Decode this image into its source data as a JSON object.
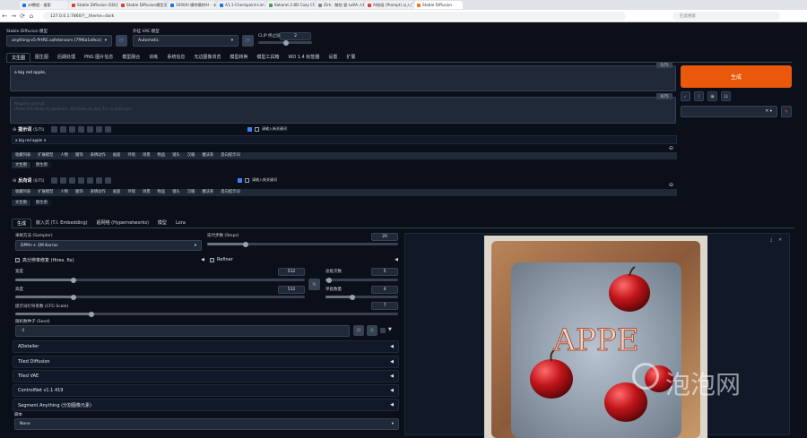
{
  "browser": {
    "tabs": [
      {
        "label": "sd教程 - 搜索",
        "color": "#1a73e8"
      },
      {
        "label": "Stable Diffusion (SD)是新",
        "color": "#e53935"
      },
      {
        "label": "Stable Diffusion模型怎么下载",
        "color": "#e53935"
      },
      {
        "label": "1000AI 模特模特AI - 卡哇伊风格",
        "color": "#1a73e8"
      },
      {
        "label": "A1.1-Checkpoint-Lim Lora - Lib",
        "color": "#1a73e8"
      },
      {
        "label": "Kakarot 2.8D Cozy Checkpoint",
        "color": "#43a047"
      },
      {
        "label": "Zirk：触觉·爱·LoRA·人物艺术",
        "color": "#888"
      },
      {
        "label": "AI绘画 (Prompt) 从入门",
        "color": "#e53935"
      },
      {
        "label": "Stable Diffusion",
        "color": "#f57c00"
      }
    ],
    "url": "127.0.0.1:7860/?__theme=dark",
    "search_placeholder": "在此搜索"
  },
  "header": {
    "model_label": "Stable Diffusion 模型",
    "model_value": "anything-v5-PrtRE.safetensors [7f96a1a9ca]",
    "vae_label": "外挂 VAE 模型",
    "vae_value": "Automatic",
    "clip_label": "CLIP 终止层数",
    "clip_value": "2"
  },
  "main_tabs": [
    "文生图",
    "图生图",
    "后期处理",
    "PNG 图片信息",
    "模型融合",
    "训练",
    "系统信息",
    "无边图像浏览",
    "模型转换",
    "模型工具箱",
    "WD 1.4 标签器",
    "设置",
    "扩展"
  ],
  "prompt": {
    "text": "a big red apple,",
    "counter": "5/75"
  },
  "negative": {
    "placeholder": "Negative prompt\n(Press Ctrl+Enter to generate, Alt+Enter to skip, Esc to interrupt)",
    "counter": "0/75"
  },
  "generate_label": "生成",
  "helper": {
    "pos_title": "提示词",
    "pos_count": "(5/75)",
    "pos_check": "请输入新关键词",
    "pos_tag": "a big red apple",
    "neg_title": "反向词",
    "neg_count": "(0/75)",
    "neg_check": "请输入新关键词",
    "cats": [
      "收藏列表",
      "扩展模型",
      "人物",
      "服饰",
      "表情动作",
      "画面",
      "环境",
      "场景",
      "物品",
      "镜头",
      "汉服",
      "魔法系",
      "反向提示词"
    ],
    "sub": [
      "文生图",
      "图生图"
    ]
  },
  "gen_tabs": [
    "生成",
    "嵌入式 (T.I. Embedding)",
    "超网络 (Hypernetworks)",
    "模型",
    "Lora"
  ],
  "params": {
    "sampler_label": "采样方法 (Sampler)",
    "sampler_value": "DPM++ 2M Karras",
    "steps_label": "迭代步数 (Steps)",
    "steps_value": "20",
    "steps_frac": 0.2,
    "hires_label": "高分辨率修复 (Hires. fix)",
    "refiner_label": "Refiner",
    "width_label": "宽度",
    "width_value": "512",
    "width_frac": 0.2,
    "height_label": "高度",
    "height_value": "512",
    "height_frac": 0.2,
    "batch_count_label": "总批次数",
    "batch_count_value": "5",
    "batch_count_frac": 0.05,
    "batch_size_label": "单批数量",
    "batch_size_value": "4",
    "batch_size_frac": 0.375,
    "cfg_label": "提示词引导系数 (CFG Scale)",
    "cfg_value": "7",
    "cfg_frac": 0.2,
    "seed_label": "随机数种子 (Seed)",
    "seed_value": "-1",
    "script_label": "脚本",
    "script_value": "None"
  },
  "accordions": [
    "ADetailer",
    "Tiled Diffusion",
    "Tiled VAE",
    "ControlNet v1.1.419",
    "Segment Anything (分割图像元素)"
  ],
  "image": {
    "caption": "APPE"
  },
  "watermark": "泡泡网"
}
